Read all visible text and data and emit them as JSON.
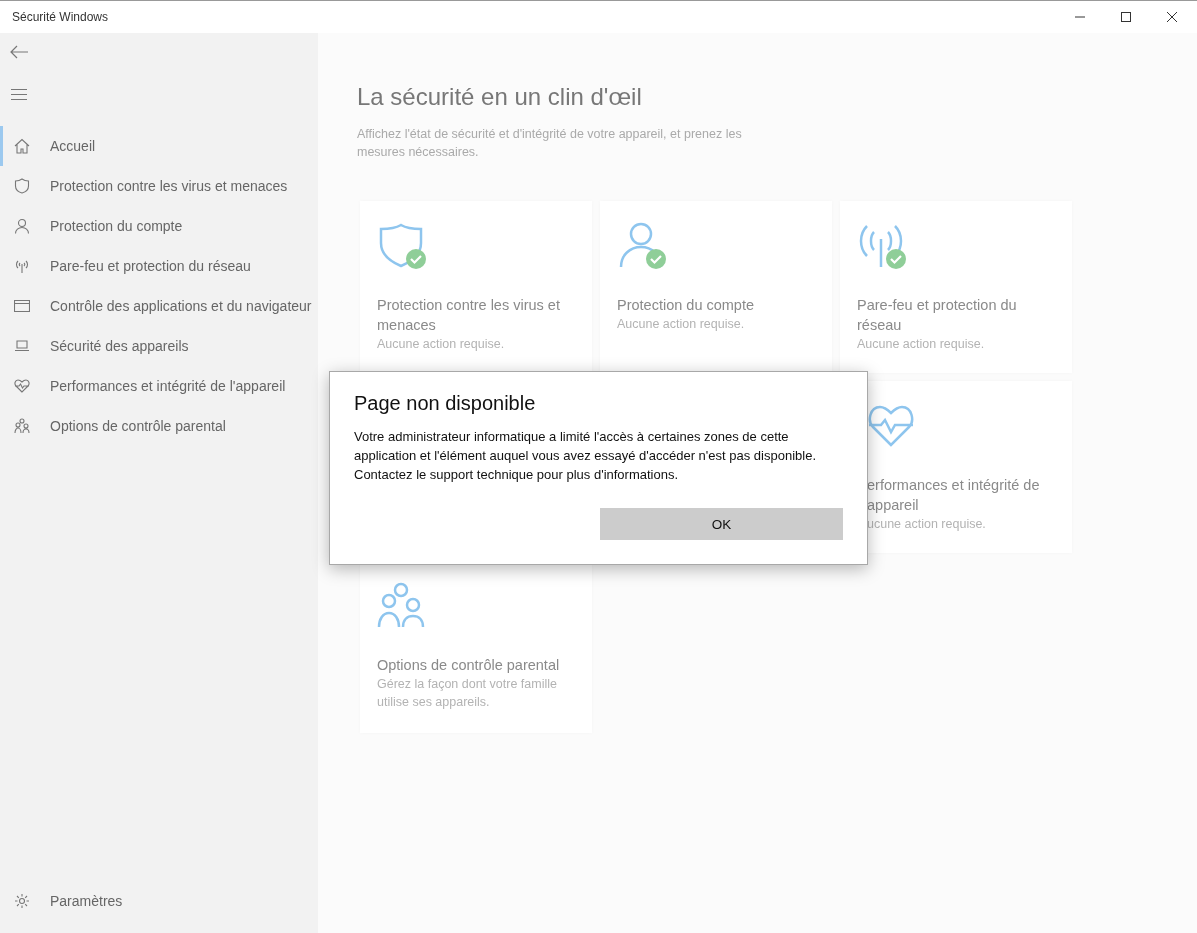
{
  "window": {
    "title": "Sécurité Windows"
  },
  "sidebar": {
    "items": [
      {
        "label": "Accueil",
        "selected": true
      },
      {
        "label": "Protection contre les virus et menaces",
        "selected": false
      },
      {
        "label": "Protection du compte",
        "selected": false
      },
      {
        "label": "Pare-feu et protection du réseau",
        "selected": false
      },
      {
        "label": "Contrôle des applications et du navigateur",
        "selected": false
      },
      {
        "label": "Sécurité des appareils",
        "selected": false
      },
      {
        "label": "Performances et intégrité de l'appareil",
        "selected": false
      },
      {
        "label": "Options de contrôle parental",
        "selected": false
      }
    ],
    "settings": "Paramètres"
  },
  "main": {
    "title": "La sécurité en un clin d'œil",
    "subtitle": "Affichez l'état de sécurité et d'intégrité de votre appareil, et prenez les mesures nécessaires.",
    "cards": [
      {
        "title": "Protection contre les virus et menaces",
        "status": "Aucune action requise.",
        "checked": true
      },
      {
        "title": "Protection du compte",
        "status": "Aucune action requise.",
        "checked": true
      },
      {
        "title": "Pare-feu et protection du réseau",
        "status": "Aucune action requise.",
        "checked": true
      },
      {
        "title": "erformances et intégrité de appareil",
        "status": "ucune action requise.",
        "checked": false
      },
      {
        "title": "Options de contrôle parental",
        "status": "Gérez la façon dont votre famille utilise ses appareils.",
        "checked": false
      }
    ]
  },
  "dialog": {
    "title": "Page non disponible",
    "message": "Votre administrateur informatique a limité l'accès à certaines zones de cette application et l'élément auquel vous avez essayé d'accéder n'est pas disponible. Contactez le support technique pour plus d'informations.",
    "button": "OK"
  }
}
